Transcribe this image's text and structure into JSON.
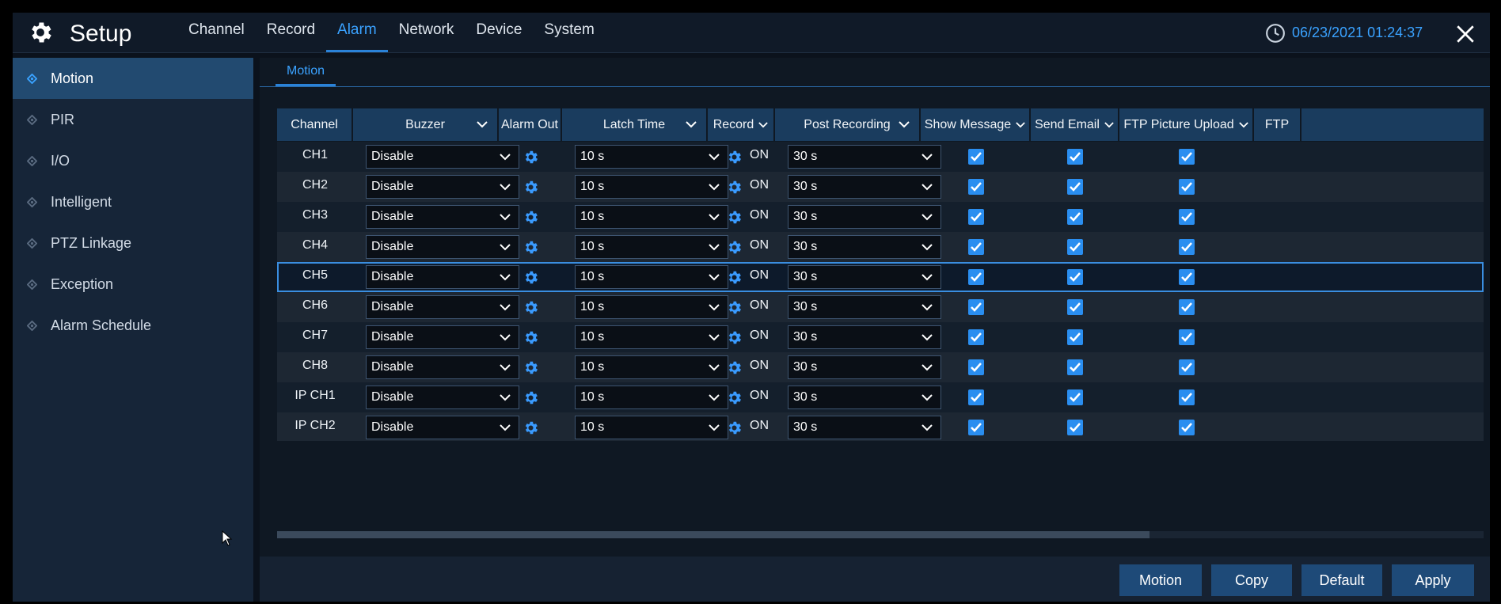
{
  "header": {
    "title": "Setup",
    "tabs": [
      "Channel",
      "Record",
      "Alarm",
      "Network",
      "Device",
      "System"
    ],
    "active_tab": "Alarm",
    "datetime": "06/23/2021 01:24:37"
  },
  "sidebar": {
    "items": [
      "Motion",
      "PIR",
      "I/O",
      "Intelligent",
      "PTZ Linkage",
      "Exception",
      "Alarm Schedule"
    ],
    "active": "Motion"
  },
  "subtab": "Motion",
  "table": {
    "headers": [
      "Channel",
      "Buzzer",
      "Alarm Out",
      "Latch Time",
      "Record",
      "Post Recording",
      "Show Message",
      "Send Email",
      "FTP Picture Upload",
      "FTP"
    ],
    "rows": [
      {
        "channel": "CH1",
        "buzzer": "Disable",
        "latch": "10 s",
        "record": "ON",
        "post": "30 s"
      },
      {
        "channel": "CH2",
        "buzzer": "Disable",
        "latch": "10 s",
        "record": "ON",
        "post": "30 s"
      },
      {
        "channel": "CH3",
        "buzzer": "Disable",
        "latch": "10 s",
        "record": "ON",
        "post": "30 s"
      },
      {
        "channel": "CH4",
        "buzzer": "Disable",
        "latch": "10 s",
        "record": "ON",
        "post": "30 s"
      },
      {
        "channel": "CH5",
        "buzzer": "Disable",
        "latch": "10 s",
        "record": "ON",
        "post": "30 s"
      },
      {
        "channel": "CH6",
        "buzzer": "Disable",
        "latch": "10 s",
        "record": "ON",
        "post": "30 s"
      },
      {
        "channel": "CH7",
        "buzzer": "Disable",
        "latch": "10 s",
        "record": "ON",
        "post": "30 s"
      },
      {
        "channel": "CH8",
        "buzzer": "Disable",
        "latch": "10 s",
        "record": "ON",
        "post": "30 s"
      },
      {
        "channel": "IP CH1",
        "buzzer": "Disable",
        "latch": "10 s",
        "record": "ON",
        "post": "30 s"
      },
      {
        "channel": "IP CH2",
        "buzzer": "Disable",
        "latch": "10 s",
        "record": "ON",
        "post": "30 s"
      }
    ],
    "selected_row": "CH5",
    "show_message_checked": true,
    "send_email_checked": true,
    "ftp_picture_upload_checked": true
  },
  "buttons": {
    "motion": "Motion",
    "copy": "Copy",
    "default": "Default",
    "apply": "Apply"
  },
  "colors": {
    "accent": "#3aa2ff",
    "checkbox": "#2a8ef0",
    "header_row": "#1a3c5e",
    "sidebar_active": "#224a70"
  },
  "icons": {
    "logo": "gear-icon",
    "clock": "clock-icon",
    "close": "close-icon",
    "sidebar_bullet": "diamond-icon",
    "alarm_out": "gear-icon",
    "dropdown": "chevron-down-icon"
  }
}
